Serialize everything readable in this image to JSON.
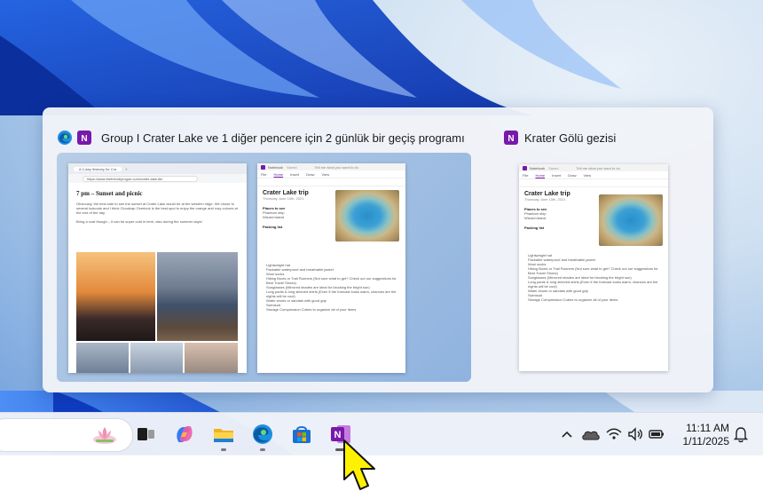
{
  "flyout": {
    "group": {
      "title": "Group I Crater Lake ve 1 diğer pencere için 2 günlük bir geçiş programı",
      "browser": {
        "tab_title": "A 2-day itinerary for Cra",
        "url": "https://www.thefriendlyrogue.com/crater-lake-itin",
        "heading": "7 pm – Sunset and picnic",
        "para1": "Obviously, the best side to see the sunset at Crater Lake would be at the western ridge. We chose to several lookouts and I think Cloudcap Overlook is the best spot to enjoy the orange and rosy colours at the end of the day.",
        "para2": "Bring a coat though – it can be super cold in here, also during the summer days!"
      },
      "onenote": {
        "app_label": "Notebook",
        "app_sub": "Saved",
        "search_hint": "Tell me what you want to do",
        "menu": [
          "File",
          "Home",
          "Insert",
          "Draw",
          "View"
        ],
        "page_title": "Crater Lake trip",
        "page_date": "Thursday June 10th, 2021",
        "places_heading": "Places to see",
        "places": [
          "Phantom ship",
          "Wizard island"
        ],
        "packing_heading": "Packing list",
        "packing": [
          "Lightweight hat",
          "Packable waterproof and breathable jacket",
          "Wool socks",
          "Hiking Boots or Trail Runners (Not sure what to get? Check out our suggestions for Best Travel Shoes)",
          "Sunglasses (Mirrored shades are ideal for blocking the bright sun)",
          "Long pants & long sleeved shirts (Even if the forecast looks warm, chances are the nights will be cool)",
          "Water shoes or sandals with good grip",
          "Swimsuit",
          "Storage Compression Cubes to organize all of your items"
        ]
      }
    },
    "single": {
      "title": "Krater Gölü gezisi"
    }
  },
  "taskbar": {
    "time": "11:11 AM",
    "date": "1/11/2025",
    "apps": [
      "widgets-icon",
      "task-view-icon",
      "copilot-icon",
      "file-explorer-icon",
      "edge-icon",
      "store-icon",
      "onenote-icon"
    ]
  },
  "colors": {
    "onenote": "#7719aa",
    "edge": "#0c59a4",
    "accent": "#0067c0"
  }
}
